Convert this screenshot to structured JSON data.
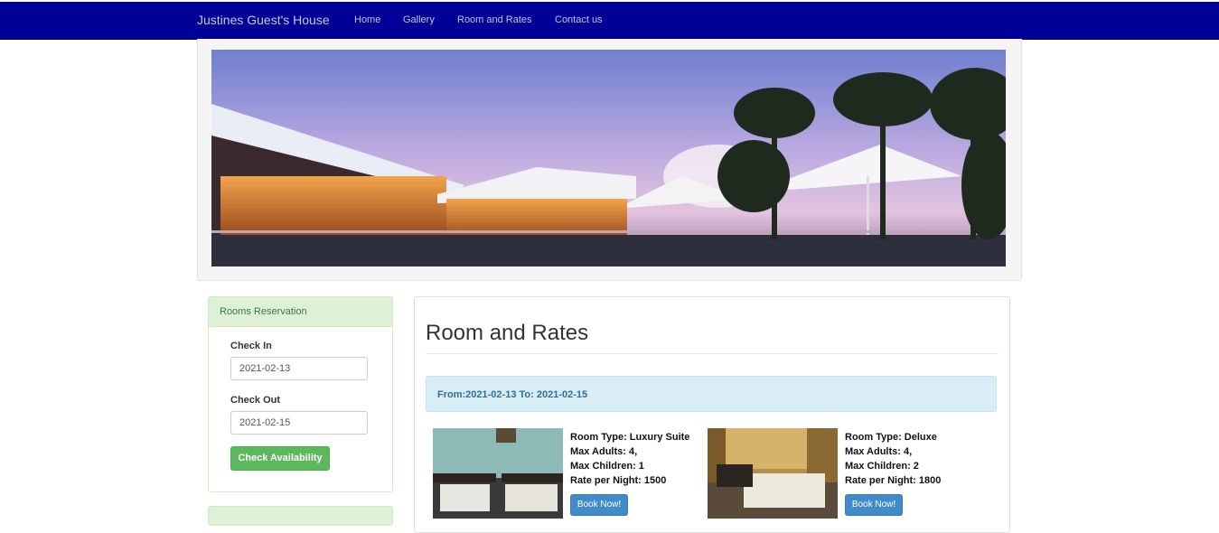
{
  "navbar": {
    "brand": "Justines Guest's House",
    "links": [
      "Home",
      "Gallery",
      "Room and Rates",
      "Contact us"
    ]
  },
  "reservation": {
    "heading": "Rooms Reservation",
    "check_in_label": "Check In",
    "check_in_value": "2021-02-13",
    "check_out_label": "Check Out",
    "check_out_value": "2021-02-15",
    "button": "Check Availability"
  },
  "main": {
    "title": "Room and Rates",
    "range": "From:2021-02-13 To: 2021-02-15",
    "rooms": [
      {
        "type": "Room Type: Luxury Suite",
        "adults": "Max Adults: 4,",
        "children": "Max Children: 1",
        "rate": "Rate per Night: 1500",
        "button": "Book Now!"
      },
      {
        "type": "Room Type: Deluxe",
        "adults": "Max Adults: 4,",
        "children": "Max Children: 2",
        "rate": "Rate per Night: 1800",
        "button": "Book Now!"
      }
    ]
  },
  "colors": {
    "navbar": "#000099",
    "panel_green": "#dff0d8",
    "alert_blue": "#d9edf7",
    "btn_green": "#5cb85c",
    "btn_blue": "#428bca"
  }
}
